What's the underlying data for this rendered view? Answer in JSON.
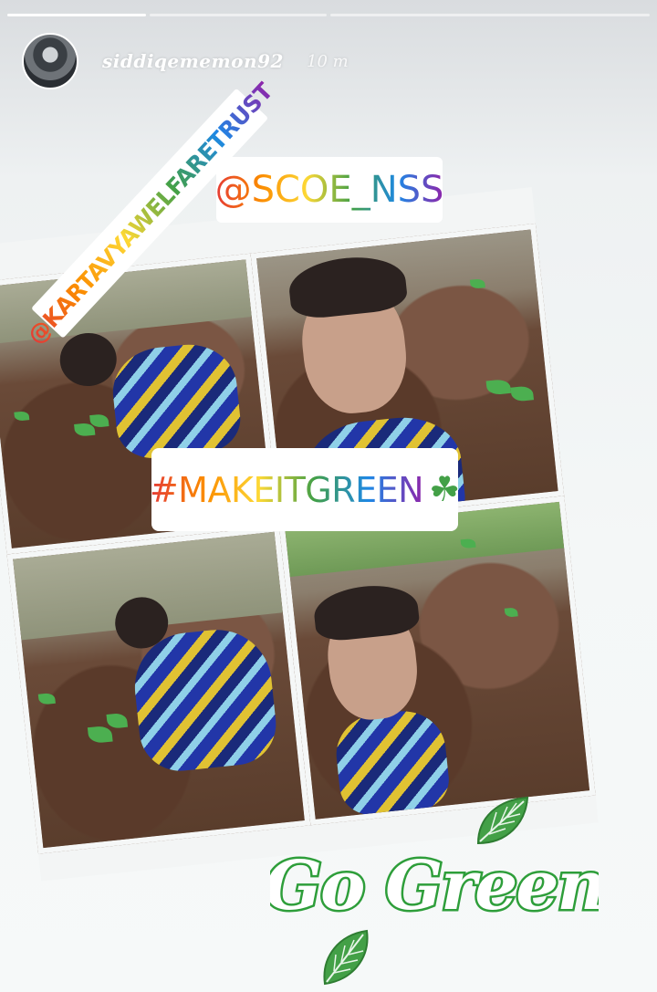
{
  "story": {
    "progress_segments": 3,
    "progress_active_index": 0,
    "username": "siddiqememon92",
    "time": "10 m"
  },
  "stickers": {
    "mention_1": "@KARTAVYAWELFARETRUST",
    "mention_2": "@SCOE_NSS",
    "hashtag": "#MAKEITGREEN",
    "hashtag_icon": "shamrock-icon",
    "slogan": "Go Green",
    "slogan_icon": "leaf-icon"
  },
  "colors": {
    "slogan_fill": "#ffffff",
    "slogan_stroke": "#2e9e3a",
    "leaf": "#43a047"
  }
}
